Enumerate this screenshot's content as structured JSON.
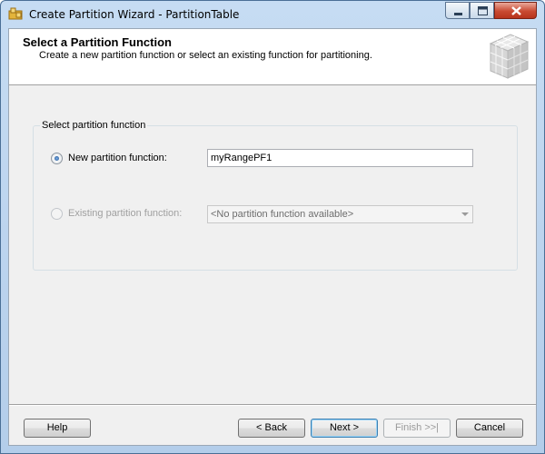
{
  "window": {
    "title": "Create Partition Wizard - PartitionTable"
  },
  "header": {
    "title": "Select a Partition Function",
    "subtitle": "Create a new partition function or select an existing function for partitioning."
  },
  "group": {
    "legend": "Select partition function",
    "new_option": {
      "label": "New partition function:",
      "selected": true,
      "value": "myRangePF1"
    },
    "existing_option": {
      "label": "Existing partition function:",
      "selected": false,
      "enabled": false,
      "combo_value": "<No partition function available>"
    }
  },
  "buttons": {
    "help": "Help",
    "back": "< Back",
    "next": "Next >",
    "finish": "Finish >>|",
    "cancel": "Cancel"
  }
}
